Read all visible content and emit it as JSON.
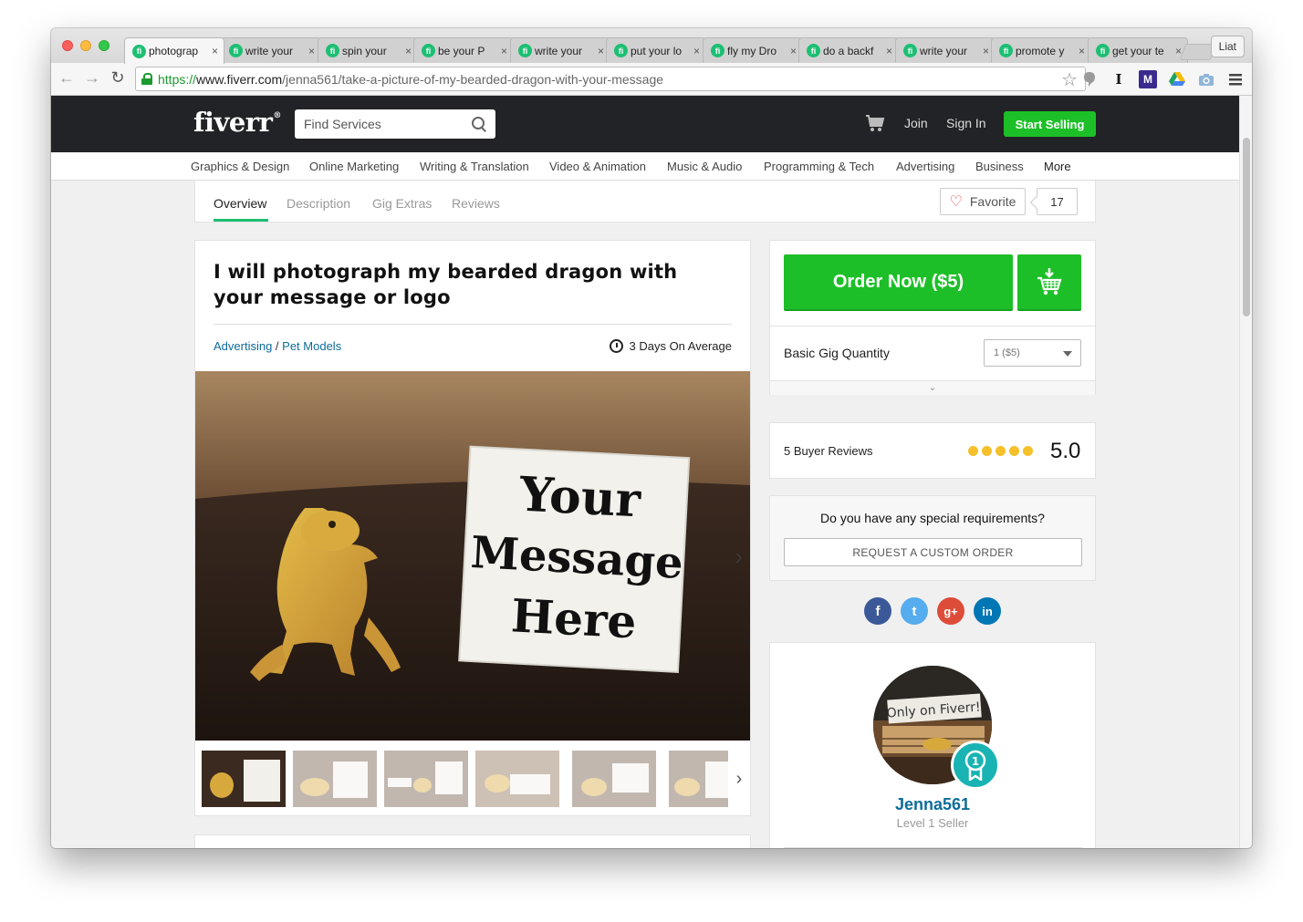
{
  "browser": {
    "tabs": [
      {
        "title": "photograp"
      },
      {
        "title": "write your"
      },
      {
        "title": "spin your"
      },
      {
        "title": "be your P"
      },
      {
        "title": "write your"
      },
      {
        "title": "put your lo"
      },
      {
        "title": "fly my Dro"
      },
      {
        "title": "do a backf"
      },
      {
        "title": "write your"
      },
      {
        "title": "promote y"
      },
      {
        "title": "get your te"
      }
    ],
    "tab_favicon": "fi",
    "tab_close": "×",
    "profile_name": "Liat",
    "url_scheme": "https://",
    "url_host": "www.fiverr.com",
    "url_path": "/jenna561/take-a-picture-of-my-bearded-dragon-with-your-message",
    "extension_i": "I",
    "extension_m": "M"
  },
  "header": {
    "logo": "fiverr",
    "logo_mark": "®",
    "search_placeholder": "Find Services",
    "join": "Join",
    "sign_in": "Sign In",
    "start_selling": "Start Selling"
  },
  "categories": [
    "Graphics & Design",
    "Online Marketing",
    "Writing & Translation",
    "Video & Animation",
    "Music & Audio",
    "Programming & Tech",
    "Advertising",
    "Business",
    "More"
  ],
  "subnav": {
    "tabs": [
      "Overview",
      "Description",
      "Gig Extras",
      "Reviews"
    ],
    "favorite_label": "Favorite",
    "favorite_count": "17"
  },
  "gig": {
    "title": "I will photograph my bearded dragon with your message or logo",
    "category": "Advertising",
    "crumb_sep": " / ",
    "subcategory": "Pet Models",
    "delivery": "3 Days On Average",
    "image_sign": [
      "Your",
      "Message",
      "Here"
    ]
  },
  "order": {
    "order_now": "Order Now ($5)",
    "quantity_label": "Basic Gig Quantity",
    "quantity_value": "1 ($5)",
    "expand": "⌄"
  },
  "reviews": {
    "label": "5 Buyer Reviews",
    "stars": 5,
    "rating": "5.0"
  },
  "requirements": {
    "question": "Do you have any special requirements?",
    "button": "REQUEST A CUSTOM ORDER"
  },
  "social": [
    {
      "icon": "facebook-icon",
      "glyph": "f",
      "color": "#3b5998"
    },
    {
      "icon": "twitter-icon",
      "glyph": "t",
      "color": "#55acee"
    },
    {
      "icon": "google-plus-icon",
      "glyph": "g+",
      "color": "#dd4b39"
    },
    {
      "icon": "linkedin-icon",
      "glyph": "in",
      "color": "#0077b5"
    }
  ],
  "seller": {
    "name": "Jenna561",
    "level": "Level 1 Seller",
    "avatar_sign": "Only on Fiverr!",
    "badge": "1"
  }
}
